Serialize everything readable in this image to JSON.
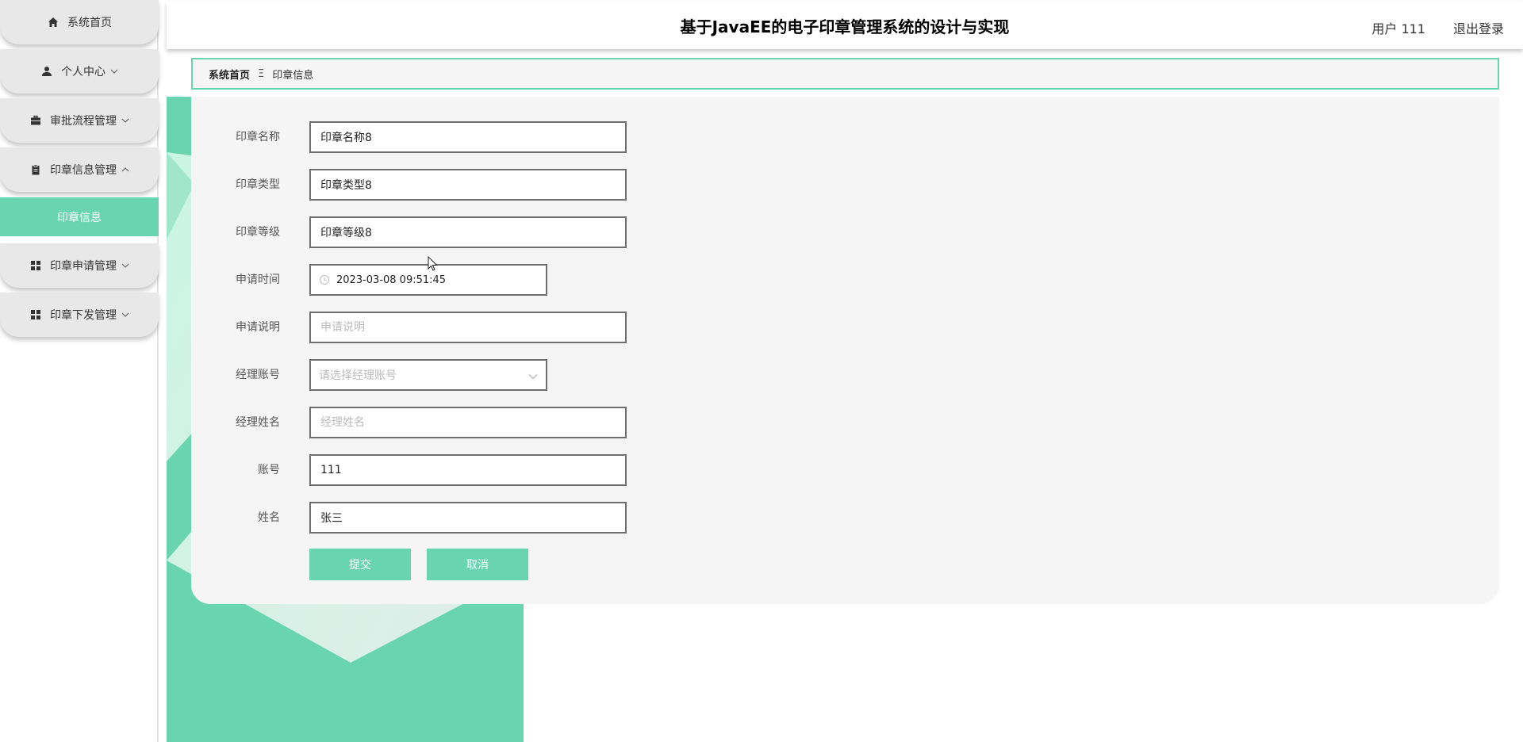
{
  "sidebar": {
    "items": [
      {
        "label": "系统首页",
        "icon": "home-icon"
      },
      {
        "label": "个人中心",
        "icon": "user-icon"
      },
      {
        "label": "审批流程管理",
        "icon": "briefcase-icon"
      },
      {
        "label": "印章信息管理",
        "icon": "clipboard-icon"
      },
      {
        "label": "印章申请管理",
        "icon": "grid-icon"
      },
      {
        "label": "印章下发管理",
        "icon": "grid-icon"
      }
    ],
    "active_submenu": {
      "label": "印章信息"
    }
  },
  "header": {
    "title": "基于JavaEE的电子印章管理系统的设计与实现",
    "user": "用户 111",
    "logout": "退出登录"
  },
  "breadcrumb": {
    "home": "系统首页",
    "separator": "Ξ",
    "current": "印章信息"
  },
  "form": {
    "seal_name": {
      "label": "印章名称",
      "value": "印章名称8"
    },
    "seal_type": {
      "label": "印章类型",
      "value": "印章类型8"
    },
    "seal_level": {
      "label": "印章等级",
      "value": "印章等级8"
    },
    "apply_time": {
      "label": "申请时间",
      "value": "2023-03-08 09:51:45"
    },
    "apply_desc": {
      "label": "申请说明",
      "placeholder": "申请说明",
      "value": ""
    },
    "manager_account": {
      "label": "经理账号",
      "placeholder": "请选择经理账号"
    },
    "manager_name": {
      "label": "经理姓名",
      "placeholder": "经理姓名",
      "value": ""
    },
    "account": {
      "label": "账号",
      "value": "111"
    },
    "name": {
      "label": "姓名",
      "value": "张三"
    },
    "submit": "提交",
    "cancel": "取消"
  },
  "colors": {
    "accent": "#69d4b0",
    "panel_bg": "#f6f5f5",
    "menu_bg": "#e8e8e8"
  }
}
